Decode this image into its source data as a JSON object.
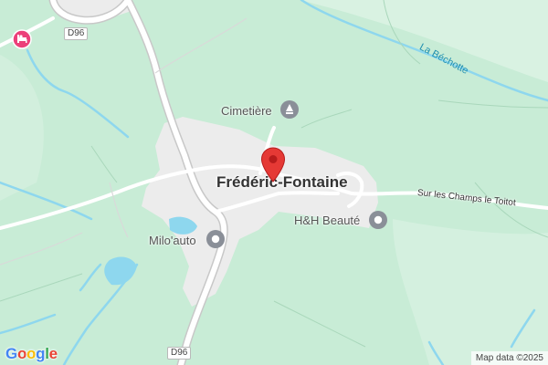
{
  "map": {
    "town_label": "Frédéric-Fontaine",
    "pois": [
      {
        "label": "Cimetière",
        "icon": "cemetery-icon"
      },
      {
        "label": "H&H Beauté",
        "icon": "shop-icon"
      },
      {
        "label": "Milo'auto",
        "icon": "car-service-icon"
      }
    ],
    "hotel_icon": "hotel-icon",
    "road_numbers": [
      "D96",
      "D96"
    ],
    "river_label": "La Béchotte",
    "street_label": "Sur les Champs le Toitot",
    "pin_icon": "location-pin-icon",
    "logo_text": "Google",
    "logo_letters": [
      "G",
      "o",
      "o",
      "g",
      "l",
      "e"
    ],
    "logo_colors": [
      "#4285F4",
      "#EA4335",
      "#FBBC05",
      "#4285F4",
      "#34A853",
      "#EA4335"
    ],
    "attribution": "Map data ©2025",
    "colors": {
      "land": "#c8ecd6",
      "urban": "#ededed",
      "water": "#8ed7ee",
      "road": "#ffffff",
      "pin": "#e53935",
      "hotel": "#ec407a"
    }
  }
}
